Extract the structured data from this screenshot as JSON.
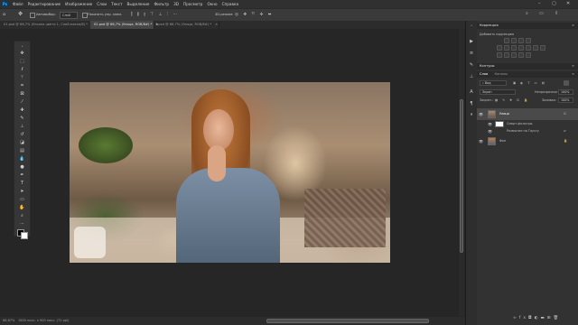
{
  "app": {
    "logo": "Ps"
  },
  "menu": [
    "Файл",
    "Редактирование",
    "Изображение",
    "Слои",
    "Текст",
    "Выделение",
    "Фильтр",
    "3D",
    "Просмотр",
    "Окно",
    "Справка"
  ],
  "options": {
    "tool_mode": "Автовыбор:",
    "target": "Слой",
    "transform_label": "Показать упр. элем.",
    "mode_3d": "3D-режим:"
  },
  "tabs": [
    {
      "label": "01.psd @ 66,7% (Ульяна цвета 1, Слой-маска/8) *",
      "active": false
    },
    {
      "label": "02.psd @ 66,7% (Улица, RGB/8#) *",
      "active": true
    },
    {
      "label": "3.psd @ 66,7% (Улица, RGB/8#) *",
      "active": false
    }
  ],
  "status": {
    "zoom": "66,67%",
    "doc_size": "1600 пикс. x 900 пикс. (72 ppi)"
  },
  "panels": {
    "corrections": {
      "title": "Коррекция",
      "add_label": "Добавить коррекцию"
    },
    "contours": {
      "title": "Контуры"
    },
    "layers_tabs": [
      "Слои",
      "Каналы"
    ],
    "filter_kind": "Вид",
    "blend_mode": "Экран",
    "opacity_label": "Непрозрачность:",
    "opacity_value": "100%",
    "lock_label": "Закреп.:",
    "fill_label": "Заливка:",
    "fill_value": "100%",
    "layers": [
      {
        "name": "Улица",
        "visible": true,
        "selected": true
      },
      {
        "name": "Смарт-фильтры",
        "visible": true,
        "selected": false,
        "sub": true
      },
      {
        "name": "Размытие по Гауссу",
        "visible": true,
        "selected": false,
        "sub": true,
        "effect": true
      },
      {
        "name": "Фон",
        "visible": true,
        "selected": false
      }
    ]
  },
  "icons": {
    "tools": [
      "move-icon",
      "marquee-icon",
      "lasso-icon",
      "magic-wand-icon",
      "crop-icon",
      "frame-icon",
      "eyedropper-icon",
      "healing-icon",
      "brush-icon",
      "stamp-icon",
      "history-brush-icon",
      "eraser-icon",
      "gradient-icon",
      "blur-icon",
      "dodge-icon",
      "pen-icon",
      "type-icon",
      "path-select-icon",
      "rectangle-icon",
      "hand-icon",
      "zoom-icon",
      "more-tools-icon"
    ]
  },
  "colors": {
    "accent": "#31a8ff",
    "ui_bg": "#262626",
    "panel_bg": "#323232"
  }
}
